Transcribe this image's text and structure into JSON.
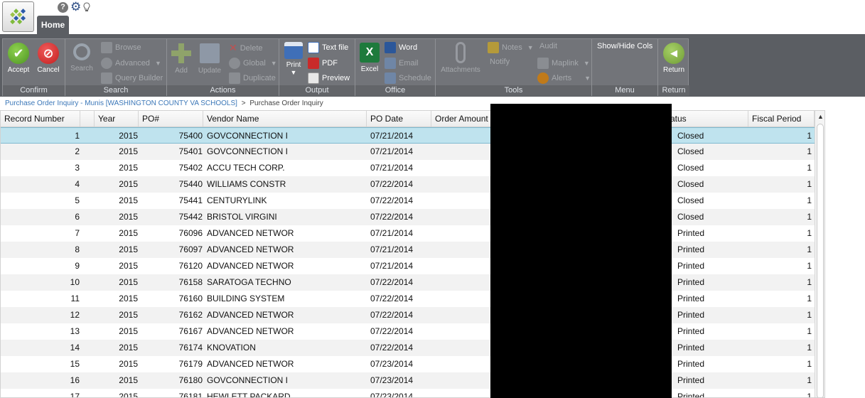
{
  "app": {
    "home_tab": "Home",
    "top_icons": [
      "help-icon",
      "gear-icon",
      "lightbulb-icon"
    ]
  },
  "ribbon": {
    "confirm": {
      "label": "Confirm",
      "accept": "Accept",
      "cancel": "Cancel"
    },
    "search": {
      "label": "Search",
      "search": "Search",
      "browse": "Browse",
      "advanced": "Advanced",
      "query_builder": "Query Builder"
    },
    "actions": {
      "label": "Actions",
      "add": "Add",
      "update": "Update",
      "delete": "Delete",
      "global": "Global",
      "duplicate": "Duplicate"
    },
    "output": {
      "label": "Output",
      "print": "Print",
      "text_file": "Text file",
      "pdf": "PDF",
      "preview": "Preview"
    },
    "office": {
      "label": "Office",
      "excel": "Excel",
      "word": "Word",
      "email": "Email",
      "schedule": "Schedule"
    },
    "tools": {
      "label": "Tools",
      "attachments": "Attachments",
      "notes": "Notes",
      "notify": "Notify",
      "audit": "Audit",
      "maplink": "Maplink",
      "alerts": "Alerts"
    },
    "menu": {
      "label": "Menu",
      "show_hide_cols": "Show/Hide Cols"
    },
    "return": {
      "label": "Return",
      "return_btn": "Return"
    }
  },
  "breadcrumb": {
    "link": "Purchase Order Inquiry - Munis [WASHINGTON COUNTY VA SCHOOLS]",
    "sep": ">",
    "current": "Purchase Order Inquiry"
  },
  "grid": {
    "columns": [
      "Record Number",
      "Year",
      "PO#",
      "Vendor Name",
      "PO Date",
      "Order Amount",
      "atus",
      "Fiscal Period"
    ],
    "rows": [
      [
        "1",
        "2015",
        "75400",
        "GOVCONNECTION I",
        "07/21/2014",
        "Closed",
        "1"
      ],
      [
        "2",
        "2015",
        "75401",
        "GOVCONNECTION I",
        "07/21/2014",
        "Closed",
        "1"
      ],
      [
        "3",
        "2015",
        "75402",
        "ACCU TECH CORP.",
        "07/21/2014",
        "Closed",
        "1"
      ],
      [
        "4",
        "2015",
        "75440",
        "WILLIAMS CONSTR",
        "07/22/2014",
        "Closed",
        "1"
      ],
      [
        "5",
        "2015",
        "75441",
        "CENTURYLINK",
        "07/22/2014",
        "Closed",
        "1"
      ],
      [
        "6",
        "2015",
        "75442",
        "BRISTOL VIRGINI",
        "07/22/2014",
        "Closed",
        "1"
      ],
      [
        "7",
        "2015",
        "76096",
        "ADVANCED NETWOR",
        "07/21/2014",
        "Printed",
        "1"
      ],
      [
        "8",
        "2015",
        "76097",
        "ADVANCED NETWOR",
        "07/21/2014",
        "Printed",
        "1"
      ],
      [
        "9",
        "2015",
        "76120",
        "ADVANCED NETWOR",
        "07/21/2014",
        "Printed",
        "1"
      ],
      [
        "10",
        "2015",
        "76158",
        "SARATOGA TECHNO",
        "07/22/2014",
        "Printed",
        "1"
      ],
      [
        "11",
        "2015",
        "76160",
        "BUILDING SYSTEM",
        "07/22/2014",
        "Printed",
        "1"
      ],
      [
        "12",
        "2015",
        "76162",
        "ADVANCED NETWOR",
        "07/22/2014",
        "Printed",
        "1"
      ],
      [
        "13",
        "2015",
        "76167",
        "ADVANCED NETWOR",
        "07/22/2014",
        "Printed",
        "1"
      ],
      [
        "14",
        "2015",
        "76174",
        "KNOVATION",
        "07/22/2014",
        "Printed",
        "1"
      ],
      [
        "15",
        "2015",
        "76179",
        "ADVANCED NETWOR",
        "07/23/2014",
        "Printed",
        "1"
      ],
      [
        "16",
        "2015",
        "76180",
        "GOVCONNECTION I",
        "07/23/2014",
        "Printed",
        "1"
      ],
      [
        "17",
        "2015",
        "76181",
        "HEWLETT PACKARD",
        "07/23/2014",
        "Printed",
        "1"
      ]
    ],
    "selected_row": 0
  },
  "colors": {
    "ribbon_bg": "#5b5e63",
    "accept_green": "#5aa02c",
    "cancel_red": "#d43232",
    "selected_row": "#bfe3ee",
    "link_blue": "#3b77b8"
  }
}
